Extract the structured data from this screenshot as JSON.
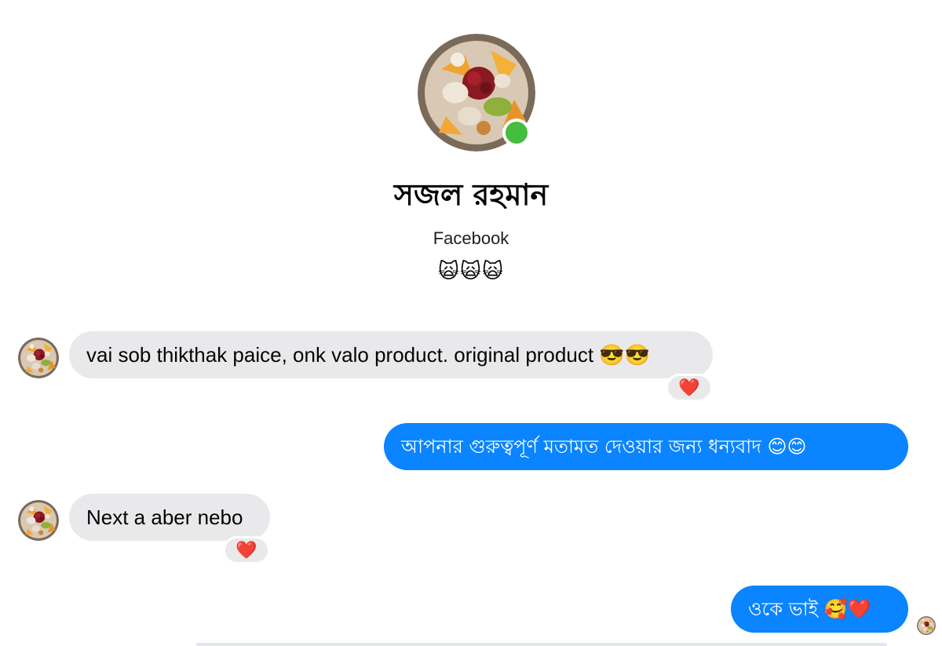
{
  "header": {
    "name": "সজল রহমান",
    "source": "Facebook",
    "emoji": "🙀🙀🙀",
    "online_status_color": "#45bd3e"
  },
  "avatar": {
    "icon": "food-plate-photo-avatar"
  },
  "messages": [
    {
      "direction": "incoming",
      "text": "vai sob thikthak paice, onk valo product. original product 😎😎",
      "reaction": "❤️"
    },
    {
      "direction": "outgoing",
      "text": "আপনার গুরুত্বপূর্ণ মতামত দেওয়ার জন্য ধন্যবাদ  😊😊"
    },
    {
      "direction": "incoming",
      "text": "Next a aber nebo",
      "reaction": "❤️"
    },
    {
      "direction": "outgoing",
      "text": "ওকে ভাই 🥰❤️"
    }
  ],
  "colors": {
    "incoming_bubble": "#e9e9eb",
    "outgoing_bubble": "#0a84ff",
    "reaction_heart": "#e02a3c"
  }
}
